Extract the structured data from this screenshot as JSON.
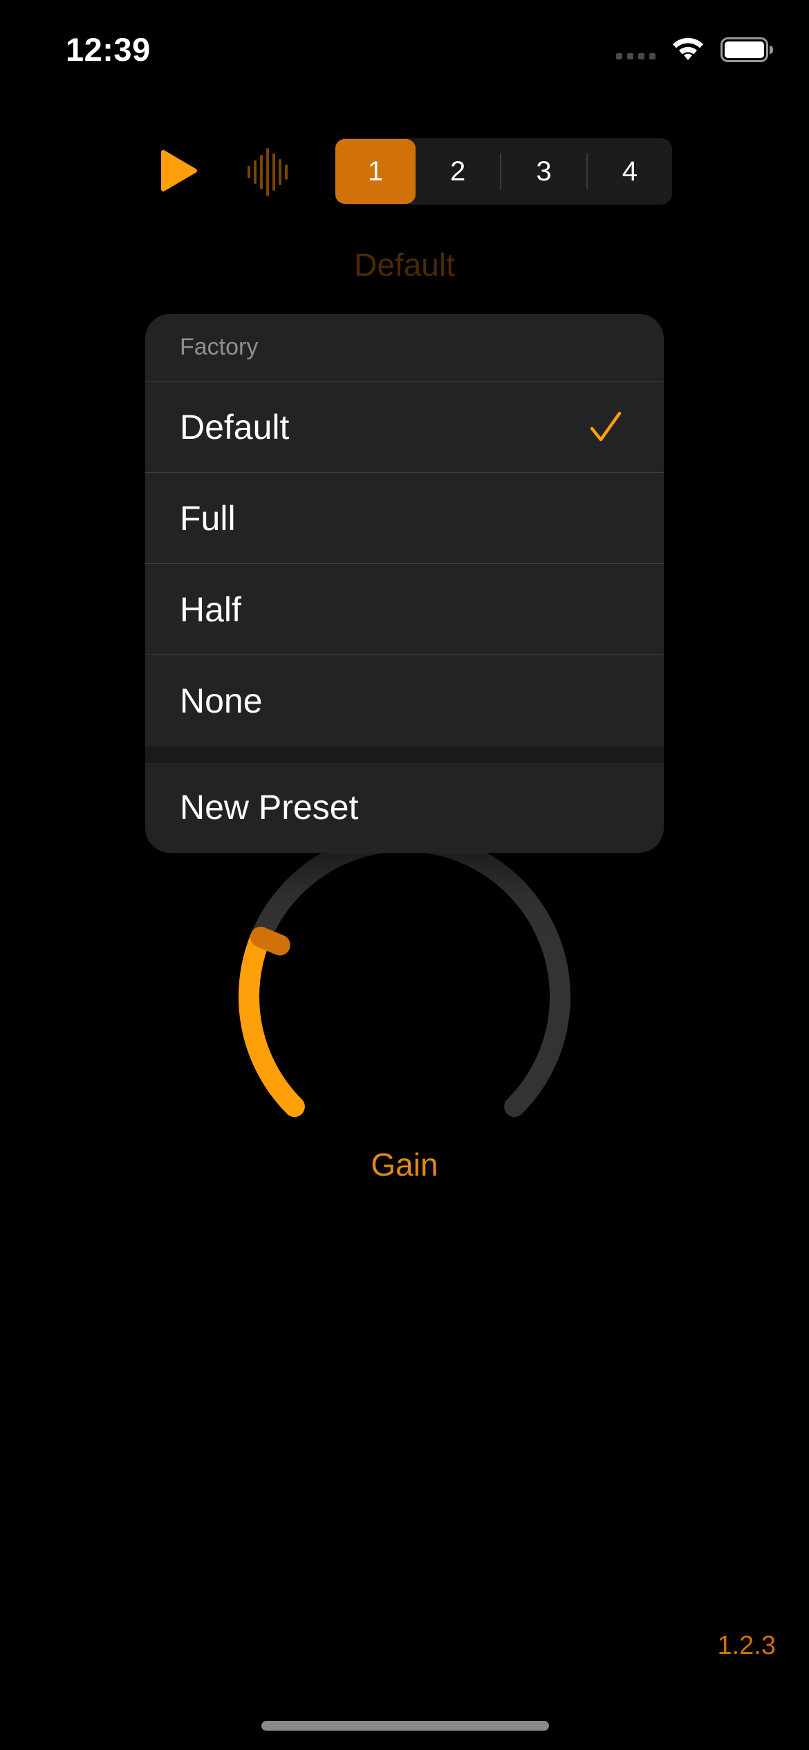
{
  "status_bar": {
    "time": "12:39",
    "icons": [
      "signal-icon",
      "wifi-icon",
      "battery-icon"
    ]
  },
  "toolbar": {
    "play_icon": "play-icon",
    "waveform_icon": "waveform-icon",
    "tabs": [
      {
        "label": "1",
        "selected": true
      },
      {
        "label": "2",
        "selected": false
      },
      {
        "label": "3",
        "selected": false
      },
      {
        "label": "4",
        "selected": false
      }
    ]
  },
  "preset": {
    "current": "Default"
  },
  "menu": {
    "section_title": "Factory",
    "items": [
      {
        "label": "Default",
        "checked": true
      },
      {
        "label": "Full",
        "checked": false
      },
      {
        "label": "Half",
        "checked": false
      },
      {
        "label": "None",
        "checked": false
      }
    ],
    "new_preset_label": "New Preset"
  },
  "knob": {
    "label": "Gain",
    "value_fraction": 0.25
  },
  "footer": {
    "version": "1.2.3"
  },
  "colors": {
    "accent": "#d0710a",
    "accent_bright": "#ff9f0a",
    "background": "#000000",
    "menu_bg": "#232325",
    "track": "#333333"
  }
}
